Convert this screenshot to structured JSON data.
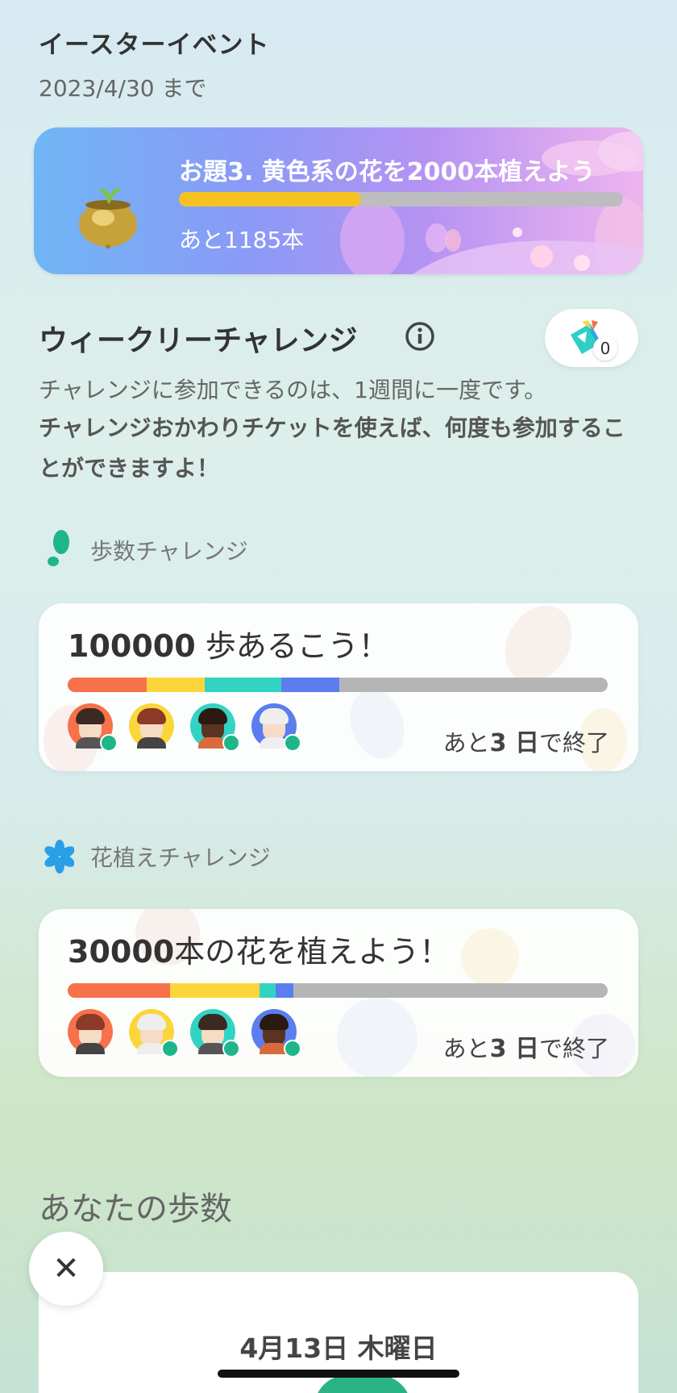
{
  "event": {
    "title": "イースターイベント",
    "until": "2023/4/30 まで",
    "task": "お題3. 黄色系の花を2000本植えよう",
    "remaining": "あと1185本",
    "progress_fraction": 0.41
  },
  "weekly": {
    "title": "ウィークリーチャレンジ",
    "ticket_count": "0",
    "desc": "チャレンジに参加できるのは、1週間に一度です。",
    "desc_bold": "チャレンジおかわりチケットを使えば、何度も参加することができますよ！"
  },
  "steps_challenge": {
    "section_label": "歩数チャレンジ",
    "goal_number": "100000",
    "goal_text": " 歩あるこう！",
    "end_prefix": "あと",
    "end_days": "3 日",
    "end_suffix": "で終了",
    "segments": [
      {
        "fraction": 0.147,
        "color": "#f7714a"
      },
      {
        "fraction": 0.107,
        "color": "#fbd63b"
      },
      {
        "fraction": 0.142,
        "color": "#33d3c2"
      },
      {
        "fraction": 0.107,
        "color": "#5b7df0"
      }
    ]
  },
  "flower_challenge": {
    "section_label": "花植えチャレンジ",
    "goal_number": "30000",
    "goal_text": "本の花を植えよう！",
    "end_prefix": "あと",
    "end_days": "3 日",
    "end_suffix": "で終了",
    "segments": [
      {
        "fraction": 0.19,
        "color": "#f7714a"
      },
      {
        "fraction": 0.165,
        "color": "#fbd63b"
      },
      {
        "fraction": 0.03,
        "color": "#33d3c2"
      },
      {
        "fraction": 0.033,
        "color": "#5b7df0"
      }
    ]
  },
  "your_steps": {
    "title": "あなたの歩数",
    "date": "4月13日 木曜日"
  },
  "icons": {
    "close": "✕"
  }
}
